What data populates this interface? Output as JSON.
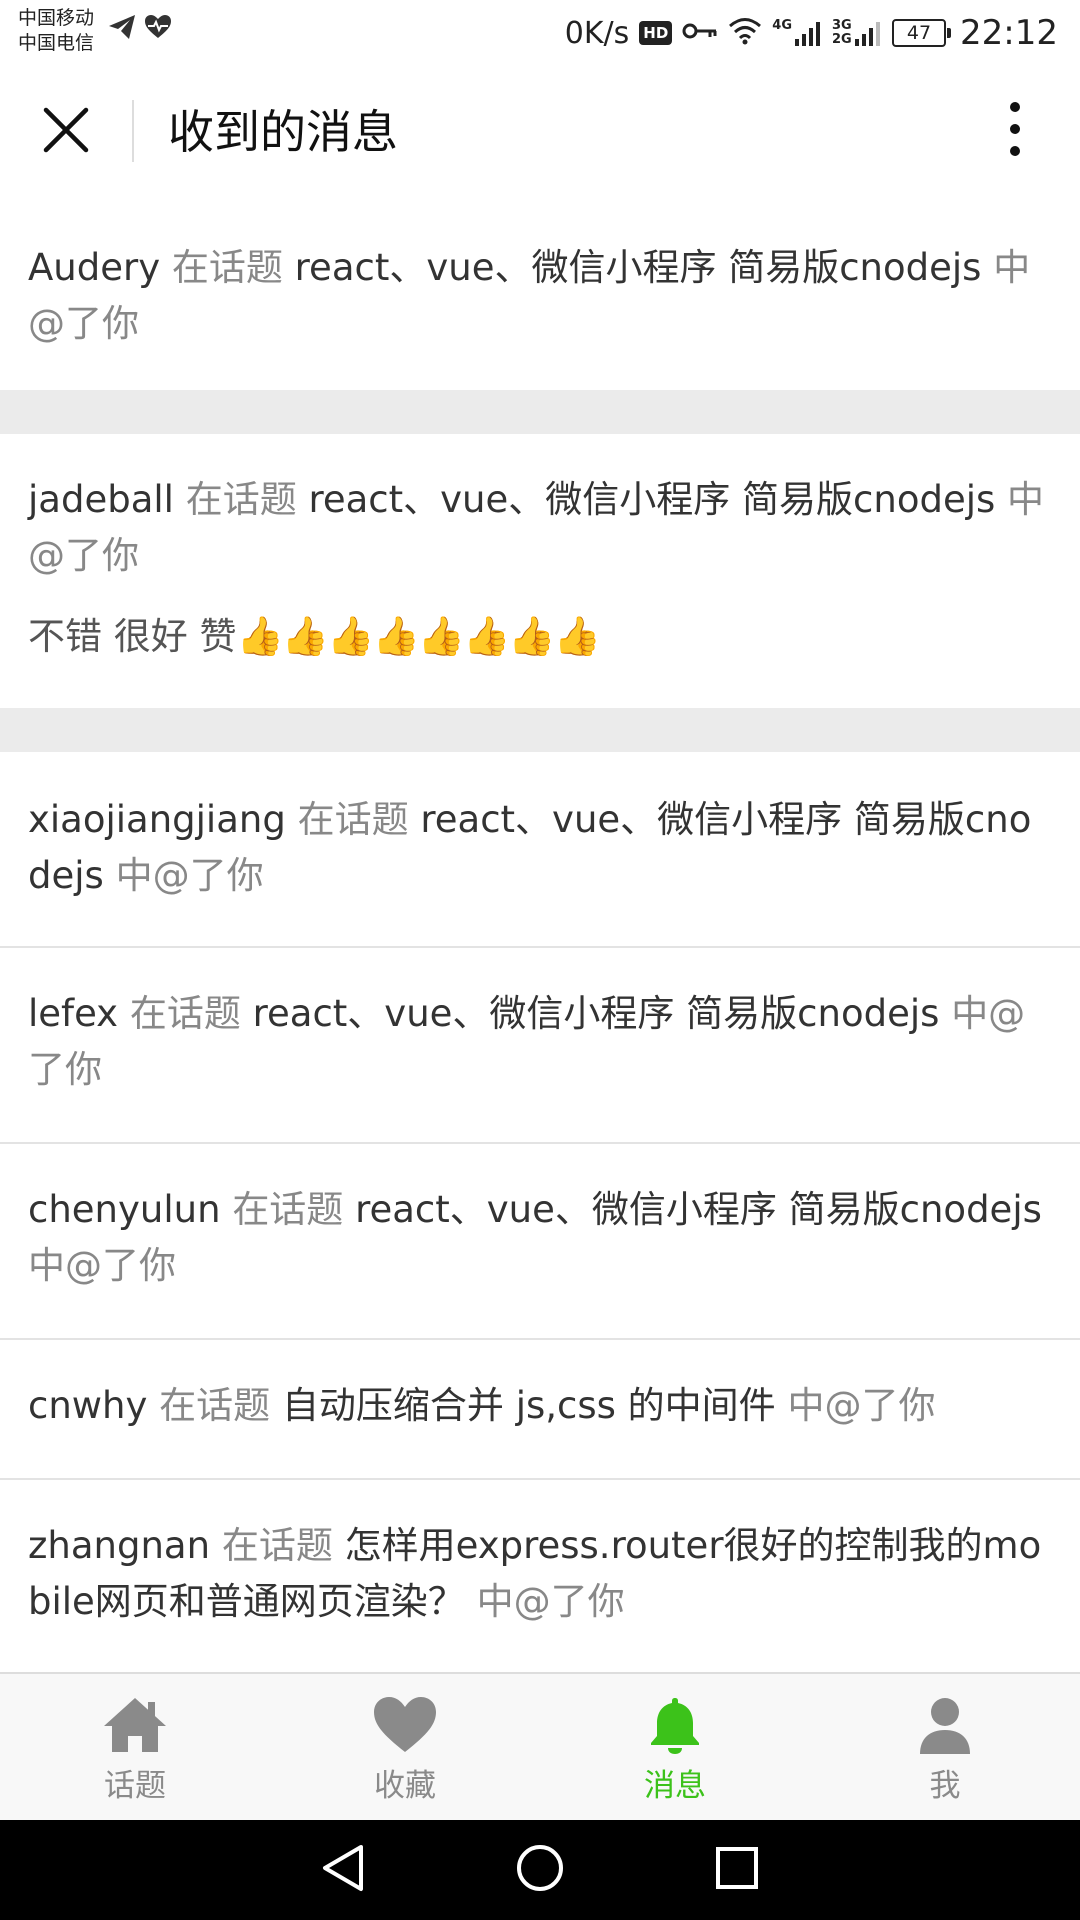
{
  "status_bar": {
    "carrier_1": "中国移动",
    "carrier_2": "中国电信",
    "net_speed": "0K/s",
    "hd_label": "HD",
    "net_4g": "4G",
    "net_3g_2g": "3G 2G",
    "battery": "47",
    "time": "22:12",
    "icons": [
      "telegram-icon",
      "health-heart-icon",
      "hd-icon",
      "key-icon",
      "wifi-icon",
      "signal-4g-icon",
      "signal-3g-2g-icon",
      "battery-icon"
    ]
  },
  "header": {
    "title": "收到的消息",
    "close_icon": "close-icon",
    "more_icon": "more-vertical-icon"
  },
  "messages": [
    {
      "user": "Audery",
      "pre": "在话题",
      "topic": "react、vue、微信小程序 简易版cnodejs",
      "post": "中@了你"
    },
    {
      "user": "jadeball",
      "pre": "在话题",
      "topic": "react、vue、微信小程序 简易版cnodejs",
      "post": "中@了你",
      "reply": "不错 很好 赞",
      "reply_emoji": "👍👍👍👍👍👍👍👍"
    },
    {
      "user": "xiaojiangjiang",
      "pre": "在话题",
      "topic": "react、vue、微信小程序 简易版cnodejs",
      "post": "中@了你"
    },
    {
      "user": "lefex",
      "pre": "在话题",
      "topic": "react、vue、微信小程序 简易版cnodejs",
      "post": "中@了你"
    },
    {
      "user": "chenyulun",
      "pre": "在话题",
      "topic": "react、vue、微信小程序 简易版cnodejs",
      "post": "中@了你"
    },
    {
      "user": "cnwhy",
      "pre": "在话题",
      "topic": "自动压缩合并 js,css 的中间件",
      "post": "中@了你"
    },
    {
      "user": "zhangnan",
      "pre": "在话题",
      "topic": "怎样用express.router很好的控制我的mobile网页和普通网页渲染？",
      "post": "中@了你"
    }
  ],
  "tabs": [
    {
      "label": "话题",
      "icon": "home-icon"
    },
    {
      "label": "收藏",
      "icon": "heart-icon"
    },
    {
      "label": "消息",
      "icon": "bell-icon",
      "active": true
    },
    {
      "label": "我",
      "icon": "user-icon"
    }
  ],
  "nav_bar": {
    "icons": [
      "back-triangle-icon",
      "home-circle-icon",
      "recents-square-icon"
    ]
  },
  "colors": {
    "active_tab": "#3cc21a",
    "inactive_tab": "#8a8a8a",
    "meta_text": "#888888",
    "separator_block": "#ebebeb"
  }
}
